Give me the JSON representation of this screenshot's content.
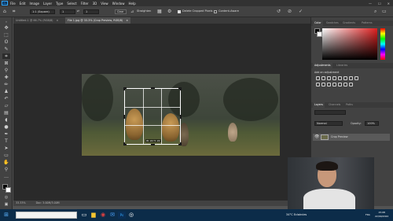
{
  "menu": [
    "File",
    "Edit",
    "Image",
    "Layer",
    "Type",
    "Select",
    "Filter",
    "3D",
    "View",
    "Window",
    "Help"
  ],
  "window_controls": [
    "—",
    "☐",
    "✕"
  ],
  "options_bar": {
    "ratio": "1:1 (Square)",
    "width_value": "1",
    "height_value": "1",
    "clear_label": "Clear",
    "straighten_label": "Straighten",
    "delete_cropped_label": "Delete Cropped Pixels",
    "content_aware_label": "Content-Aware"
  },
  "tabs": [
    {
      "label": "Untitled-1 @ 66.7% (RGB/8)"
    },
    {
      "label": "File 1.jpg @ 33.3% (Crop Preview, RGB/8)"
    }
  ],
  "crop_readout": "W: 22  H: 22",
  "status": {
    "zoom": "33.33%",
    "doc": "Doc: 3.00M/3.00M"
  },
  "color_panel": {
    "tabs": [
      "Color",
      "Swatches",
      "Gradients",
      "Patterns"
    ]
  },
  "adjustments_panel": {
    "tabs": [
      "Adjustments",
      "Libraries"
    ],
    "hint": "Add an adjustment"
  },
  "layers_panel": {
    "tabs": [
      "Layers",
      "Channels",
      "Paths"
    ],
    "blend_mode": "Normal",
    "opacity_label": "Opacity:",
    "opacity_value": "100%",
    "layer_name": "Crop Preview"
  },
  "taskbar": {
    "weather": "34°C  Eclaircies",
    "lang": "FRA",
    "time": "15:08",
    "date": "22/09/2022"
  },
  "colors": {
    "accent": "#31a8ff",
    "panel": "#424242",
    "canvas": "#2a2a2a",
    "taskbar": "#0c2c49"
  }
}
